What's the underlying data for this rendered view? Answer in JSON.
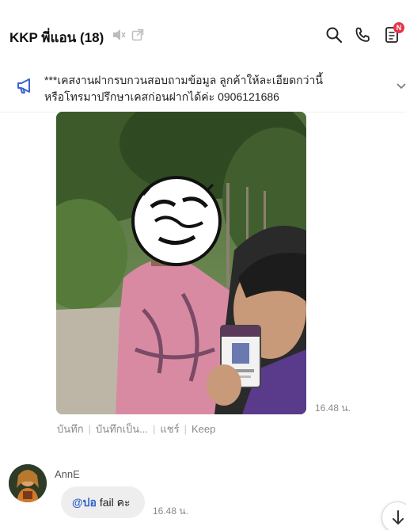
{
  "header": {
    "name": "KKP พี่แอน",
    "member_count": "(18)",
    "badge": "N",
    "icons": [
      "mute-icon",
      "external-link-icon",
      "search-icon",
      "phone-icon",
      "notes-icon"
    ]
  },
  "announcement": {
    "line1": "***เคสงานฝากรบกวนสอบถามข้อมูล ลูกค้าให้ละเอียดกว่านี้",
    "line2": "หรือโทรมาปรึกษาเคสก่อนฝากได้ค่ะ 0906121686",
    "icon": "megaphone-icon"
  },
  "messages": {
    "photo_time": "16.48 น.",
    "actions": [
      "บันทึก",
      "บันทึกเป็น...",
      "แชร์",
      "Keep"
    ],
    "sender": "AnnE",
    "mention": "@ปอ",
    "text": " fail คะ",
    "text_time": "16.48 น."
  },
  "colors": {
    "accent": "#2f62c9",
    "badge": "#e5364a",
    "megaphone": "#3a63d6",
    "bubble": "#eeeeee"
  }
}
